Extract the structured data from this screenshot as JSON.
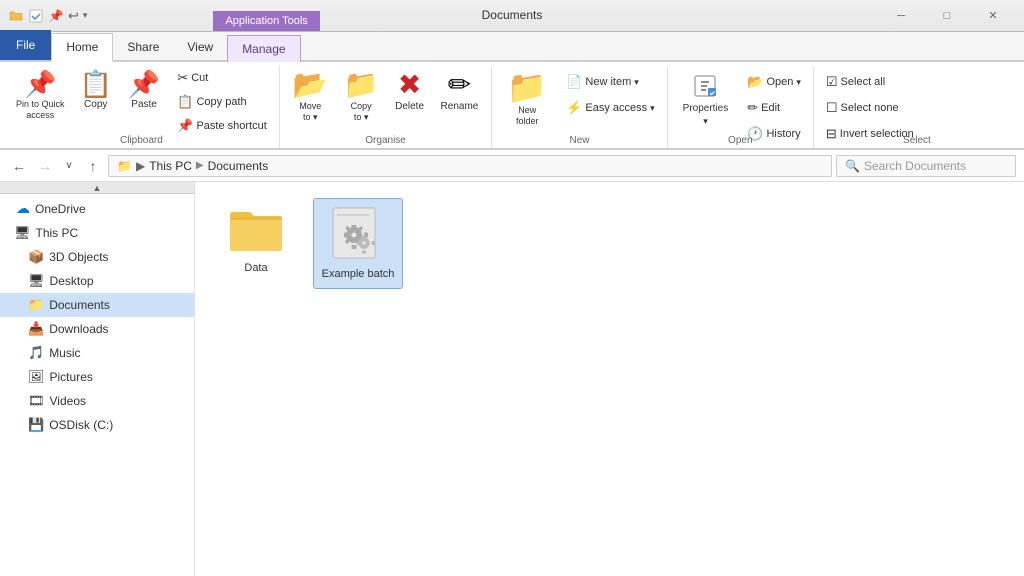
{
  "titlebar": {
    "title": "Documents",
    "app_tools_tab": "Application Tools",
    "controls": {
      "minimize": "─",
      "maximize": "□",
      "close": "✕"
    }
  },
  "ribbon_tabs": {
    "file": "File",
    "home": "Home",
    "share": "Share",
    "view": "View",
    "manage": "Manage"
  },
  "ribbon": {
    "clipboard": {
      "label": "Clipboard",
      "pin_to_quick_access": "Pin to Quick\naccess",
      "copy": "Copy",
      "paste": "Paste",
      "cut": "Cut",
      "copy_path": "Copy path",
      "paste_shortcut": "Paste shortcut"
    },
    "organise": {
      "label": "Organise",
      "move_to": "Move\nto",
      "copy_to": "Copy\nto",
      "delete": "Delete",
      "rename": "Rename"
    },
    "new": {
      "label": "New",
      "new_folder": "New\nfolder",
      "new_item": "New item",
      "easy_access": "Easy access"
    },
    "open": {
      "label": "Open",
      "properties": "Properties",
      "open": "Open",
      "edit": "Edit",
      "history": "History"
    },
    "select": {
      "label": "Select",
      "select_all": "Select all",
      "select_none": "Select none",
      "invert_selection": "Invert selection"
    }
  },
  "addressbar": {
    "path": "This PC > Documents",
    "search_placeholder": "Search Documents"
  },
  "sidebar": {
    "items": [
      {
        "id": "onedrive",
        "label": "OneDrive",
        "icon": "☁",
        "indent": 1
      },
      {
        "id": "thispc",
        "label": "This PC",
        "icon": "💻",
        "indent": 1
      },
      {
        "id": "3dobjects",
        "label": "3D Objects",
        "icon": "📦",
        "indent": 2
      },
      {
        "id": "desktop",
        "label": "Desktop",
        "icon": "🖥",
        "indent": 2
      },
      {
        "id": "documents",
        "label": "Documents",
        "icon": "📁",
        "indent": 2,
        "active": true
      },
      {
        "id": "downloads",
        "label": "Downloads",
        "icon": "📥",
        "indent": 2
      },
      {
        "id": "music",
        "label": "Music",
        "icon": "🎵",
        "indent": 2
      },
      {
        "id": "pictures",
        "label": "Pictures",
        "icon": "🖼",
        "indent": 2
      },
      {
        "id": "videos",
        "label": "Videos",
        "icon": "🎞",
        "indent": 2
      },
      {
        "id": "osdisk",
        "label": "OSDisk (C:)",
        "icon": "💾",
        "indent": 2
      }
    ]
  },
  "files": [
    {
      "id": "data",
      "name": "Data",
      "type": "folder"
    },
    {
      "id": "example-batch",
      "name": "Example batch",
      "type": "batch",
      "selected": true
    }
  ],
  "icons": {
    "back": "←",
    "forward": "→",
    "recent": "∨",
    "up": "↑",
    "search": "🔍",
    "location": "📍",
    "chevron_down": "▾",
    "check": "✓"
  }
}
